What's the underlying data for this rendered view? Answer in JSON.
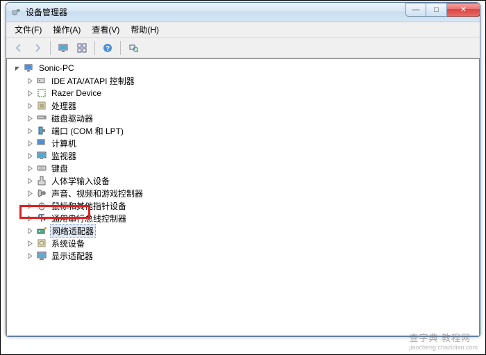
{
  "window": {
    "title": "设备管理器"
  },
  "window_controls": {
    "minimize": "—",
    "maximize": "□",
    "close": "✕"
  },
  "menu": {
    "file": "文件(F)",
    "action": "操作(A)",
    "view": "查看(V)",
    "help": "帮助(H)"
  },
  "tree": {
    "root": "Sonic-PC",
    "nodes": [
      "IDE ATA/ATAPI 控制器",
      "Razer Device",
      "处理器",
      "磁盘驱动器",
      "端口 (COM 和 LPT)",
      "计算机",
      "监视器",
      "键盘",
      "人体学输入设备",
      "声音、视频和游戏控制器",
      "鼠标和其他指针设备",
      "通用串行总线控制器",
      "网络适配器",
      "系统设备",
      "显示适配器"
    ],
    "selected_index": 12
  },
  "watermark": {
    "main": "查字典 教程网",
    "sub": "jiaocheng.chazidian.com"
  }
}
